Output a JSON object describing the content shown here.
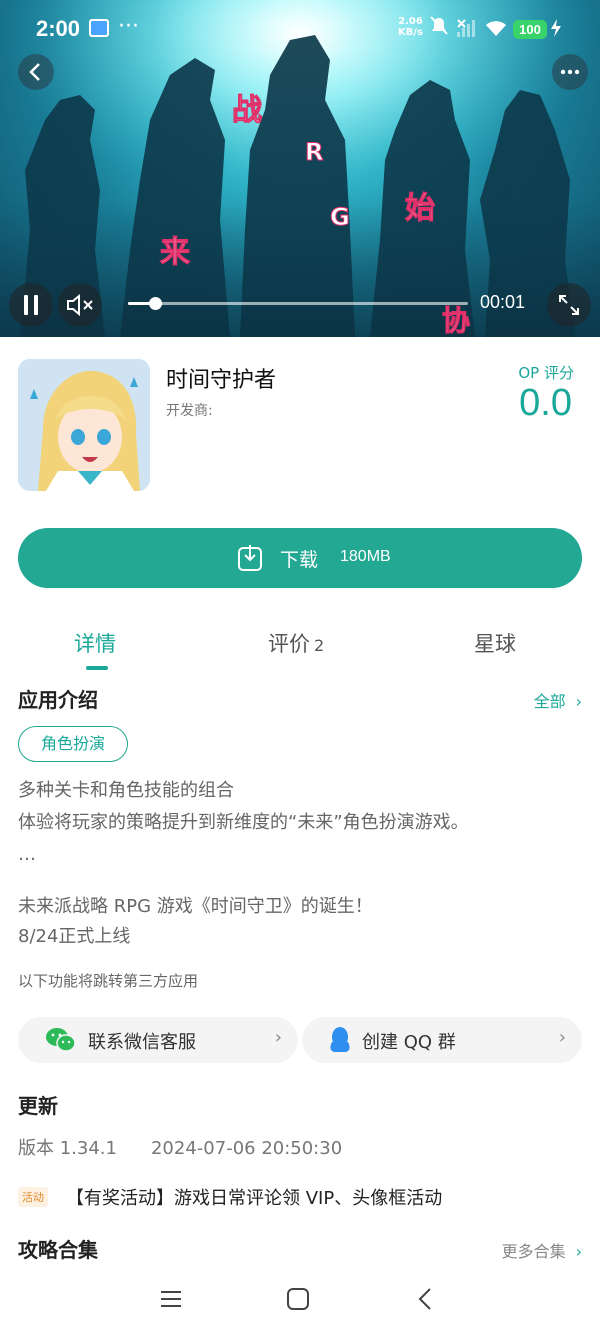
{
  "status_bar": {
    "time": "2:00",
    "speed_value": "2.06",
    "speed_unit": "KB/s",
    "battery": "100",
    "dots": "···"
  },
  "video": {
    "current_time": "00:01",
    "progress": 0.08,
    "overlay_chars": [
      "战",
      "R",
      "G",
      "始",
      "来",
      "协"
    ]
  },
  "app": {
    "title": "时间守护者",
    "developer_label": "开发商:",
    "score_label": "OP 评分",
    "score_value": "0.0"
  },
  "download": {
    "label": "下载",
    "size": "180MB"
  },
  "tabs": [
    {
      "label": "详情",
      "count": ""
    },
    {
      "label": "评价",
      "count": "2"
    },
    {
      "label": "星球",
      "count": ""
    }
  ],
  "intro": {
    "title": "应用介绍",
    "more": "全部",
    "tag": "角色扮演",
    "lines": [
      "多种关卡和角色技能的组合",
      "体验将玩家的策略提升到新维度的“未来”角色扮演游戏。",
      "…",
      "未来派战略 RPG 游戏《时间守卫》的诞生！",
      "8/24正式上线"
    ],
    "third_party_note": "以下功能将跳转第三方应用"
  },
  "contacts": [
    {
      "label": "联系微信客服",
      "icon": "wechat-icon"
    },
    {
      "label": "创建 QQ 群",
      "icon": "qq-icon"
    }
  ],
  "update": {
    "title": "更新",
    "version": "版本 1.34.1",
    "date": "2024-07-06 20:50:30",
    "badge": "活动",
    "activity": "【有奖活动】游戏日常评论领 VIP、头像框活动"
  },
  "guides": {
    "title": "攻略合集",
    "more": "更多合集"
  },
  "colors": {
    "accent": "#22a893",
    "accent_text": "#1aa89a"
  }
}
